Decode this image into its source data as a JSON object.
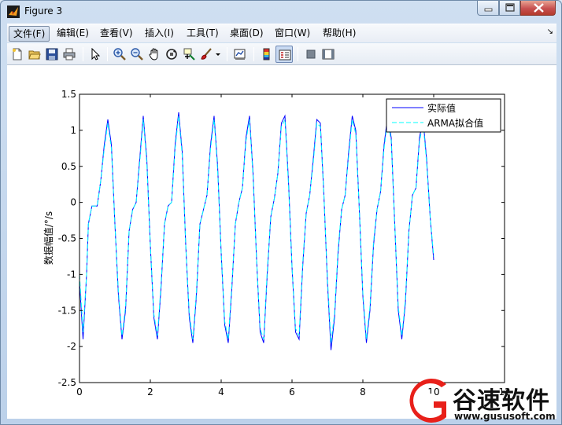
{
  "window": {
    "title": "Figure 3"
  },
  "menubar": {
    "items": [
      {
        "label": "文件(F)",
        "active": true
      },
      {
        "label": "编辑(E)"
      },
      {
        "label": "查看(V)"
      },
      {
        "label": "插入(I)"
      },
      {
        "label": "工具(T)"
      },
      {
        "label": "桌面(D)"
      },
      {
        "label": "窗口(W)"
      },
      {
        "label": "帮助(H)"
      }
    ],
    "overflow_glyph": "↘"
  },
  "toolbar": {
    "icons": [
      "new-figure-icon",
      "open-file-icon",
      "save-icon",
      "print-icon",
      "edit-plot-arrow-icon",
      "zoom-in-icon",
      "zoom-out-icon",
      "pan-hand-icon",
      "rotate-3d-icon",
      "data-cursor-icon",
      "brush-icon",
      "brush-dropdown-icon",
      "link-plot-icon",
      "colorbar-icon",
      "legend-icon",
      "hide-plot-tools-icon",
      "show-plot-tools-icon"
    ]
  },
  "chart_data": {
    "type": "line",
    "xlim": [
      0,
      12
    ],
    "ylim": [
      -2.5,
      1.5
    ],
    "xticks": [
      "0",
      "2",
      "4",
      "6",
      "8",
      "10",
      "12"
    ],
    "yticks": [
      "1.5",
      "1",
      "0.5",
      "0",
      "-0.5",
      "-1",
      "-1.5",
      "-2",
      "-2.5"
    ],
    "xlabel": "",
    "ylabel": "数据幅值/°/s",
    "legend": {
      "placement": "top-right",
      "entries": [
        "实际值",
        "ARMA拟合值"
      ]
    },
    "series": [
      {
        "name": "实际值",
        "color": "#0000ff",
        "style": "solid",
        "x": [
          0,
          0.1,
          0.2,
          0.25,
          0.35,
          0.5,
          0.6,
          0.7,
          0.8,
          0.9,
          1.0,
          1.1,
          1.2,
          1.3,
          1.4,
          1.5,
          1.6,
          1.7,
          1.8,
          1.9,
          2.0,
          2.1,
          2.2,
          2.3,
          2.4,
          2.5,
          2.6,
          2.7,
          2.8,
          2.9,
          3.0,
          3.1,
          3.2,
          3.3,
          3.4,
          3.5,
          3.6,
          3.7,
          3.8,
          3.9,
          4.0,
          4.1,
          4.2,
          4.3,
          4.4,
          4.5,
          4.6,
          4.7,
          4.8,
          4.9,
          5.0,
          5.1,
          5.2,
          5.3,
          5.4,
          5.5,
          5.6,
          5.7,
          5.8,
          5.9,
          6.0,
          6.1,
          6.2,
          6.3,
          6.4,
          6.5,
          6.6,
          6.7,
          6.8,
          6.9,
          7.0,
          7.1,
          7.2,
          7.3,
          7.4,
          7.5,
          7.6,
          7.7,
          7.8,
          7.9,
          8.0,
          8.1,
          8.2,
          8.3,
          8.4,
          8.5,
          8.6,
          8.7,
          8.8,
          8.9,
          9.0,
          9.1,
          9.2,
          9.3,
          9.4,
          9.5,
          9.6,
          9.7,
          9.8,
          9.9,
          10.0
        ],
        "y": [
          -1.1,
          -1.9,
          -1.0,
          -0.3,
          -0.05,
          -0.05,
          0.3,
          0.8,
          1.15,
          0.8,
          -0.3,
          -1.3,
          -1.9,
          -1.5,
          -0.4,
          -0.1,
          0.0,
          0.6,
          1.2,
          0.6,
          -0.6,
          -1.6,
          -1.9,
          -1.2,
          -0.3,
          -0.05,
          0.0,
          0.8,
          1.25,
          0.7,
          -0.6,
          -1.6,
          -1.95,
          -1.3,
          -0.3,
          -0.1,
          0.1,
          0.8,
          1.2,
          0.5,
          -0.7,
          -1.7,
          -1.95,
          -1.2,
          -0.3,
          0.0,
          0.2,
          0.9,
          1.2,
          0.4,
          -0.8,
          -1.8,
          -1.95,
          -1.0,
          -0.2,
          0.05,
          0.4,
          1.1,
          1.2,
          0.3,
          -0.9,
          -1.8,
          -1.9,
          -0.9,
          -0.15,
          0.1,
          0.6,
          1.15,
          1.1,
          0.1,
          -1.1,
          -2.05,
          -1.6,
          -0.7,
          -0.1,
          0.1,
          0.7,
          1.2,
          1.0,
          -0.1,
          -1.3,
          -1.95,
          -1.5,
          -0.6,
          -0.1,
          0.15,
          0.8,
          1.2,
          0.9,
          -0.3,
          -1.5,
          -1.9,
          -1.4,
          -0.4,
          0.1,
          0.2,
          0.9,
          1.15,
          0.6,
          -0.2,
          -0.8
        ]
      },
      {
        "name": "ARMA拟合值",
        "color": "#00ffff",
        "style": "dashed",
        "x": [
          0,
          0.1,
          0.2,
          0.25,
          0.35,
          0.5,
          0.6,
          0.7,
          0.8,
          0.9,
          1.0,
          1.1,
          1.2,
          1.3,
          1.4,
          1.5,
          1.6,
          1.7,
          1.8,
          1.9,
          2.0,
          2.1,
          2.2,
          2.3,
          2.4,
          2.5,
          2.6,
          2.7,
          2.8,
          2.9,
          3.0,
          3.1,
          3.2,
          3.3,
          3.4,
          3.5,
          3.6,
          3.7,
          3.8,
          3.9,
          4.0,
          4.1,
          4.2,
          4.3,
          4.4,
          4.5,
          4.6,
          4.7,
          4.8,
          4.9,
          5.0,
          5.1,
          5.2,
          5.3,
          5.4,
          5.5,
          5.6,
          5.7,
          5.8,
          5.9,
          6.0,
          6.1,
          6.2,
          6.3,
          6.4,
          6.5,
          6.6,
          6.7,
          6.8,
          6.9,
          7.0,
          7.1,
          7.2,
          7.3,
          7.4,
          7.5,
          7.6,
          7.7,
          7.8,
          7.9,
          8.0,
          8.1,
          8.2,
          8.3,
          8.4,
          8.5,
          8.6,
          8.7,
          8.8,
          8.9,
          9.0,
          9.1,
          9.2,
          9.3,
          9.4,
          9.5,
          9.6,
          9.7,
          9.8,
          9.9,
          10.0
        ],
        "y": [
          -1.0,
          -1.8,
          -1.0,
          -0.3,
          -0.05,
          -0.05,
          0.3,
          0.75,
          1.1,
          0.75,
          -0.3,
          -1.25,
          -1.85,
          -1.45,
          -0.4,
          -0.1,
          0.0,
          0.55,
          1.15,
          0.55,
          -0.6,
          -1.55,
          -1.85,
          -1.15,
          -0.3,
          -0.05,
          0.0,
          0.75,
          1.2,
          0.65,
          -0.6,
          -1.55,
          -1.9,
          -1.25,
          -0.3,
          -0.1,
          0.1,
          0.75,
          1.15,
          0.45,
          -0.7,
          -1.65,
          -1.9,
          -1.15,
          -0.3,
          0.0,
          0.2,
          0.85,
          1.15,
          0.35,
          -0.8,
          -1.75,
          -1.9,
          -0.95,
          -0.2,
          0.05,
          0.4,
          1.05,
          1.15,
          0.25,
          -0.9,
          -1.75,
          -1.85,
          -0.85,
          -0.15,
          0.1,
          0.55,
          1.1,
          1.05,
          0.1,
          -1.05,
          -1.95,
          -1.55,
          -0.65,
          -0.1,
          0.1,
          0.65,
          1.15,
          0.95,
          -0.1,
          -1.25,
          -1.9,
          -1.45,
          -0.55,
          -0.1,
          0.15,
          0.75,
          1.15,
          0.85,
          -0.3,
          -1.45,
          -1.85,
          -1.35,
          -0.4,
          0.1,
          0.2,
          0.85,
          1.1,
          0.55,
          -0.2,
          -0.75
        ]
      }
    ],
    "grid": false
  },
  "watermark": {
    "brand": "谷速软件",
    "url": "www.gususoft.com",
    "logo_color": "#e8201a"
  }
}
